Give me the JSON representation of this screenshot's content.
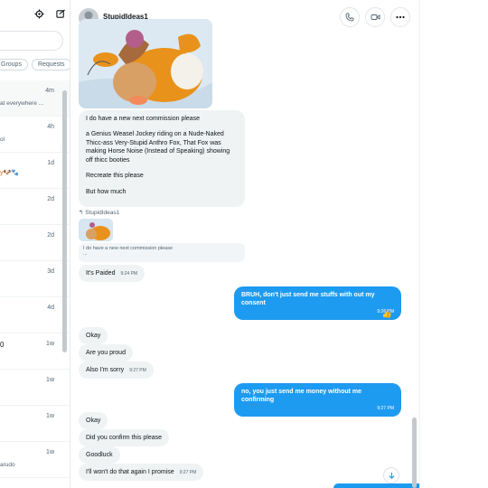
{
  "toolbar": {
    "settings_icon": "gear-icon",
    "compose_icon": "compose-icon"
  },
  "filters": [
    "Groups",
    "Requests"
  ],
  "conversations": [
    {
      "time": "4m",
      "snippet": "at everywhere ...",
      "active": true
    },
    {
      "time": "4h",
      "snippet": "ol"
    },
    {
      "time": "1d",
      "snippet": "y🐶🐾"
    },
    {
      "time": "2d",
      "snippet": ""
    },
    {
      "time": "2d",
      "snippet": ""
    },
    {
      "time": "3d",
      "snippet": ""
    },
    {
      "time": "4d",
      "snippet": ""
    },
    {
      "time": "1w",
      "snippet": "0"
    },
    {
      "time": "1w",
      "snippet": ""
    },
    {
      "time": "1w",
      "snippet": ""
    },
    {
      "time": "1w",
      "snippet": "arudo"
    }
  ],
  "chat": {
    "sender": "StupidIdeas1",
    "header_actions": [
      "phone-icon",
      "video-icon",
      "more-icon"
    ],
    "message1": {
      "line1": "I do have a new next commission please",
      "line2": " a Genius Weasel Jockey riding on a Nude-Naked Thicc-ass Very-Stupid Anthro Fox, That Fox was making Horse Noise (Instead of Speaking) showing off thicc booties",
      "line3": "Recreate this please",
      "line4": "But how much"
    },
    "reply": {
      "label": "StupidIdeas1",
      "quoted": "I do have a new next commission please",
      "quoted_more": "..."
    },
    "msg_paided": {
      "text": "It's Paided",
      "time": "9:24 PM"
    },
    "out1": {
      "text": "BRUH, don't just send me stuffs with out my consent",
      "time": "9:26 PM"
    },
    "msg_okay1": {
      "text": "Okay"
    },
    "msg_proud": {
      "text": "Are you proud"
    },
    "msg_sorry": {
      "text": "Also I'm sorry",
      "time": "9:27 PM"
    },
    "out2": {
      "text": "no, you just send me money without me confirming",
      "time": "9:27 PM"
    },
    "msg_okay2": {
      "text": "Okay"
    },
    "msg_confirm": {
      "text": "Did you confirm this please"
    },
    "msg_goodluck": {
      "text": "Goodluck"
    },
    "msg_promise": {
      "text": "I'll won't do that again I promise",
      "time": "9:27 PM"
    },
    "reaction": "👍"
  },
  "colors": {
    "accent": "#1d9bf0",
    "bubble_in": "#eff3f4",
    "fox_orange": "#e8921c"
  }
}
